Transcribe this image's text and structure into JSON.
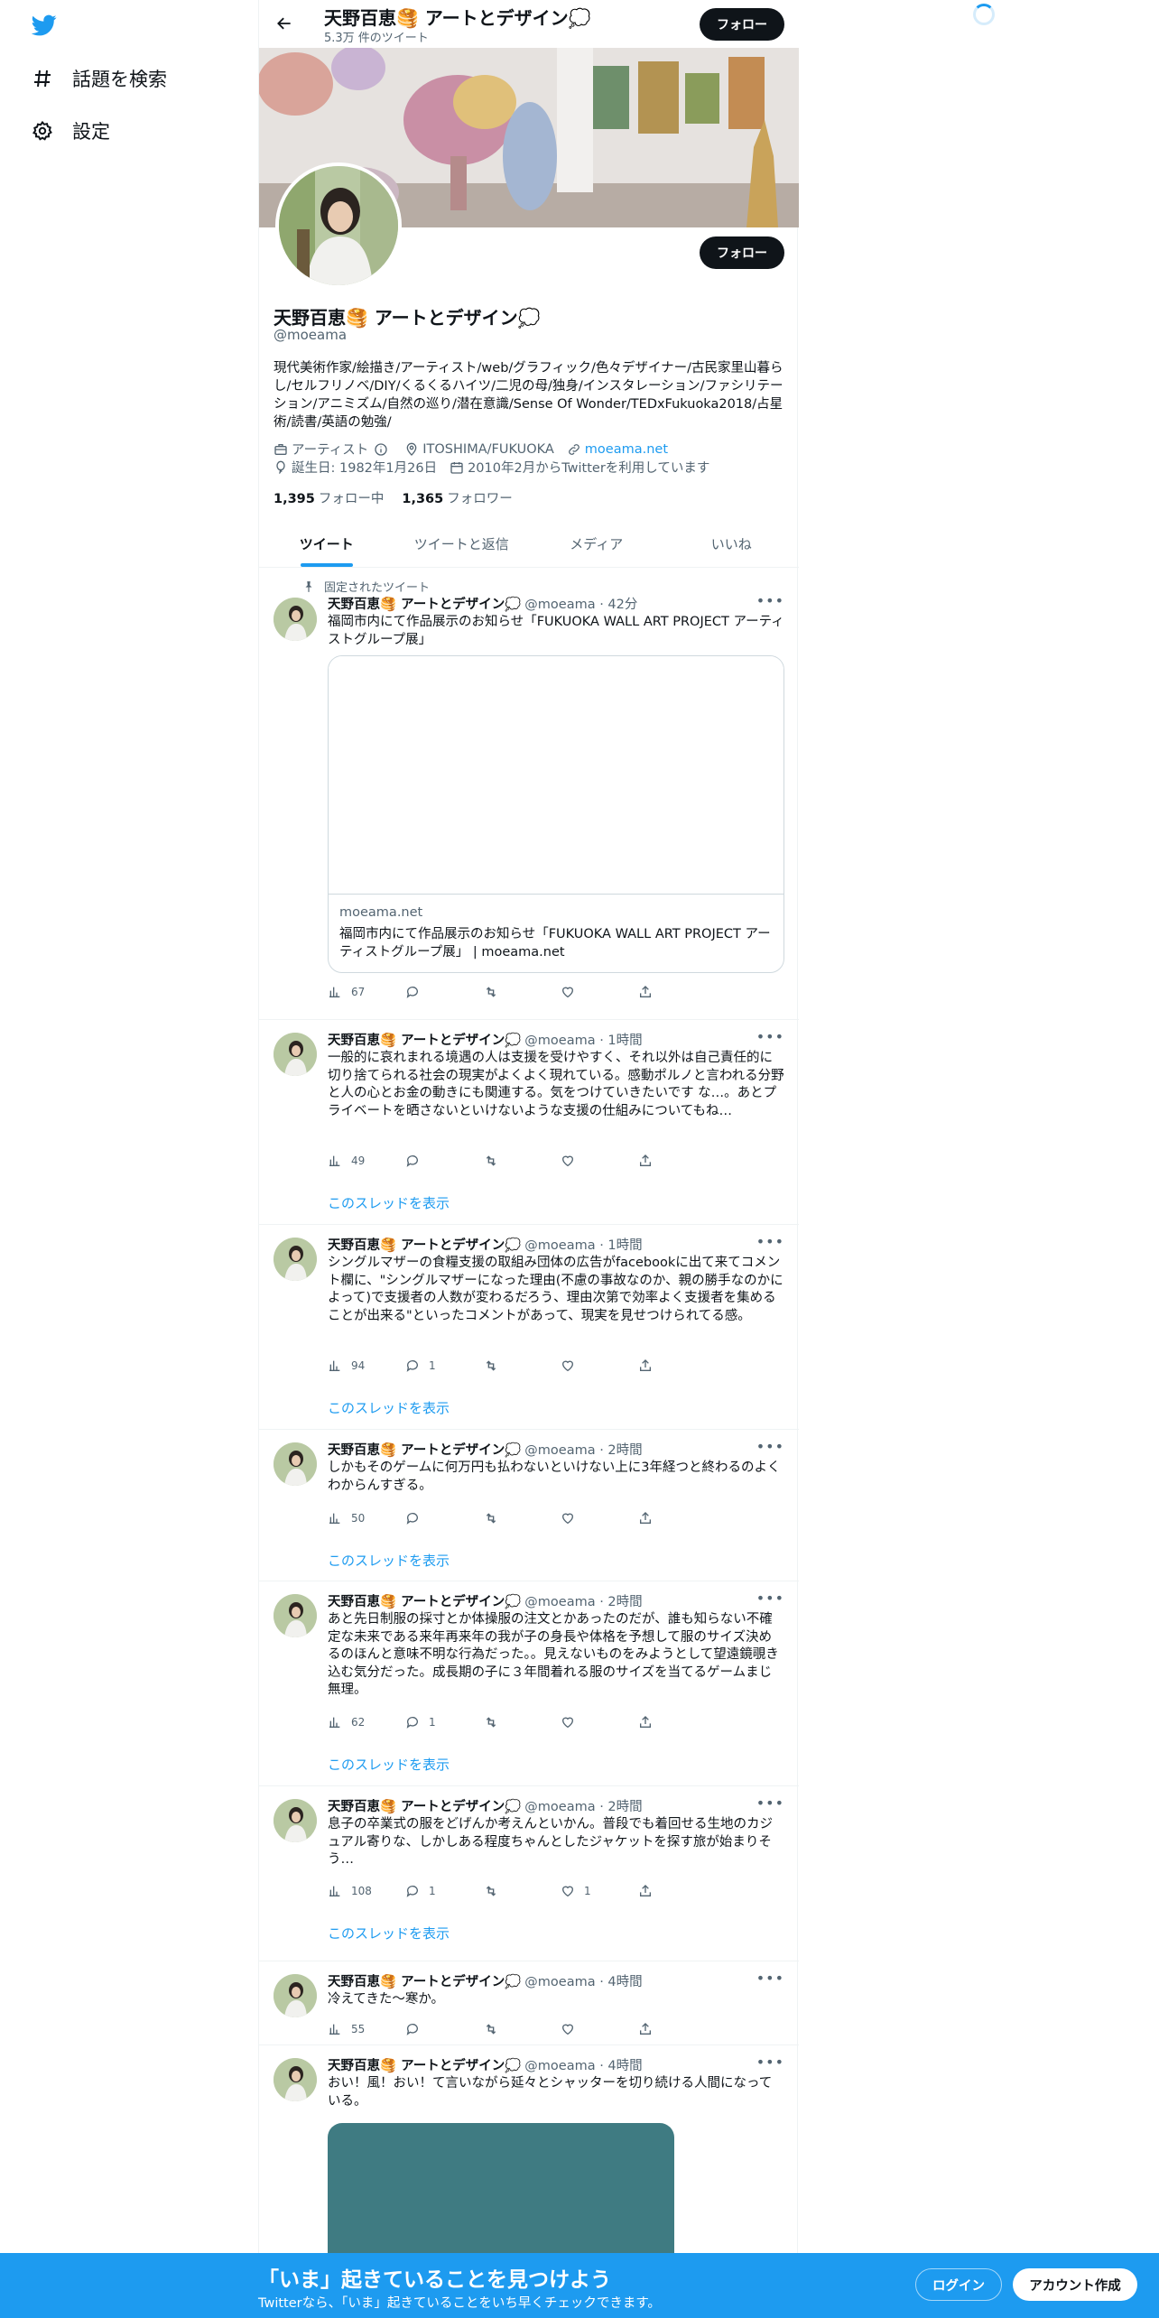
{
  "nav": {
    "explore_label": "話題を検索",
    "settings_label": "設定"
  },
  "header": {
    "display_name": "天野百恵🥞 アートとデザイン💭",
    "tweet_count": "5.3万 件のツイート",
    "follow_label": "フォロー"
  },
  "profile": {
    "display_name": "天野百恵🥞 アートとデザイン💭",
    "handle": "@moeama",
    "follow_label": "フォロー",
    "bio": "現代美術作家/絵描き/アーティスト/web/グラフィック/色々デザイナー/古民家里山暮らし/セルフリノベ/DIY/くるくるハイツ/二児の母/独身/インスタレーション/ファシリテーション/アニミズム/自然の巡り/潜在意識/Sense Of Wonder/TEDxFukuoka2018/占星術/読書/英語の勉強/",
    "category": "アーティスト",
    "location": "ITOSHIMA/FUKUOKA",
    "website": "moeama.net",
    "birthday": "誕生日: 1982年1月26日",
    "joined": "2010年2月からTwitterを利用しています",
    "following_count": "1,395",
    "following_label": "フォロー中",
    "followers_count": "1,365",
    "followers_label": "フォロワー"
  },
  "tabs": [
    "ツイート",
    "ツイートと返信",
    "メディア",
    "いいね"
  ],
  "tweets": [
    {
      "pinned_label": "固定されたツイート",
      "name": "天野百恵🥞 アートとデザイン💭",
      "handle_time": "@moeama · 42分",
      "text": "福岡市内にて作品展示のお知らせ「FUKUOKA WALL ART PROJECT アーティストグループ展」",
      "card_domain": "moeama.net",
      "card_title": "福岡市内にて作品展示のお知らせ「FUKUOKA WALL ART PROJECT アーティストグループ展」 | moeama.net",
      "views": "67",
      "replies": "",
      "retweets": "",
      "likes": ""
    },
    {
      "name": "天野百恵🥞 アートとデザイン💭",
      "handle_time": "@moeama · 1時間",
      "text": "一般的に哀れまれる境遇の人は支援を受けやすく、それ以外は自己責任的に切り捨てられる社会の現実がよくよく現れている。感動ポルノと言われる分野と人の心とお金の動きにも関連する。気をつけていきたいです な…。あとプライベートを晒さないといけないような支援の仕組みについてもね…",
      "views": "49",
      "replies": "",
      "retweets": "",
      "likes": "",
      "thread_label": "このスレッドを表示"
    },
    {
      "name": "天野百恵🥞 アートとデザイン💭",
      "handle_time": "@moeama · 1時間",
      "text": "シングルマザーの食糧支援の取組み団体の広告がfacebookに出て来てコメント欄に、\"シングルマザーになった理由(不慮の事故なのか、親の勝手なのかによって)で支援者の人数が変わるだろう、理由次第で効率よく支援者を集めることが出来る\"といったコメントがあって、現実を見せつけられてる感。",
      "views": "94",
      "replies": "1",
      "retweets": "",
      "likes": "",
      "thread_label": "このスレッドを表示"
    },
    {
      "name": "天野百恵🥞 アートとデザイン💭",
      "handle_time": "@moeama · 2時間",
      "text": "しかもそのゲームに何万円も払わないといけない上に3年経つと終わるのよくわからんすぎる。",
      "views": "50",
      "replies": "",
      "retweets": "",
      "likes": "",
      "thread_label": "このスレッドを表示"
    },
    {
      "name": "天野百恵🥞 アートとデザイン💭",
      "handle_time": "@moeama · 2時間",
      "text": "あと先日制服の採寸とか体操服の注文とかあったのだが、誰も知らない不確定な未来である来年再来年の我が子の身長や体格を予想して服のサイズ決めるのほんと意味不明な行為だった。。見えないものをみようとして望遠鏡覗き込む気分だった。成長期の子に３年間着れる服のサイズを当てるゲームまじ無理。",
      "views": "62",
      "replies": "1",
      "retweets": "",
      "likes": "",
      "thread_label": "このスレッドを表示"
    },
    {
      "name": "天野百恵🥞 アートとデザイン💭",
      "handle_time": "@moeama · 2時間",
      "text": "息子の卒業式の服をどげんか考えんといかん。普段でも着回せる生地のカジュアル寄りな、しかしある程度ちゃんとしたジャケットを探す旅が始まりそう…",
      "views": "108",
      "replies": "1",
      "retweets": "",
      "likes": "1",
      "thread_label": "このスレッドを表示"
    },
    {
      "name": "天野百恵🥞 アートとデザイン💭",
      "handle_time": "@moeama · 4時間",
      "text": "冷えてきた〜寒か。",
      "views": "55",
      "replies": "",
      "retweets": "",
      "likes": ""
    },
    {
      "name": "天野百恵🥞 アートとデザイン💭",
      "handle_time": "@moeama · 4時間",
      "text": "おい！風！おい！て言いながら延々とシャッターを切り続ける人間になっている。"
    }
  ],
  "bottom_bar": {
    "title": "「いま」起きていることを見つけよう",
    "subtitle": "Twitterなら、「いま」起きていることをいち早くチェックできます。",
    "login_label": "ログイン",
    "signup_label": "アカウント作成"
  },
  "colors": {
    "accent": "#1d9bf0",
    "text": "#0f1419",
    "muted": "#536471",
    "border": "#eff3f4"
  }
}
